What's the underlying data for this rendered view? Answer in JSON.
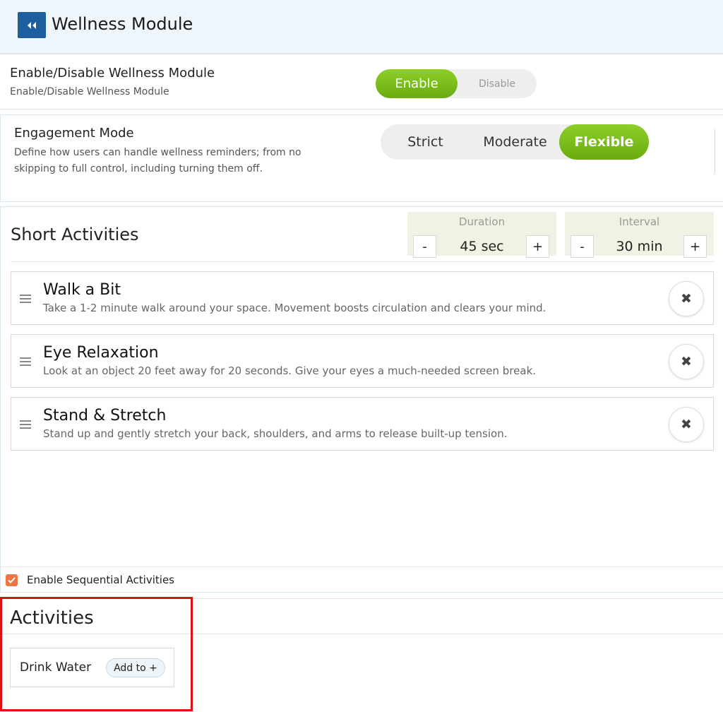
{
  "header": {
    "title": "Wellness Module",
    "back_icon": "double-chevron-left-icon"
  },
  "enable_row": {
    "title": "Enable/Disable Wellness Module",
    "subtitle": "Enable/Disable Wellness Module",
    "on_label": "Enable",
    "off_label": "Disable",
    "selected": "Enable"
  },
  "engagement": {
    "title": "Engagement Mode",
    "description_line1": "Define how users can handle wellness reminders; from no",
    "description_line2": "skipping to full control, including turning them off.",
    "options": [
      "Strict",
      "Moderate",
      "Flexible"
    ],
    "selected": "Flexible"
  },
  "short_activities": {
    "title": "Short Activities",
    "duration": {
      "label": "Duration",
      "value": "45 sec",
      "minus": "-",
      "plus": "+"
    },
    "interval": {
      "label": "Interval",
      "value": "30 min",
      "minus": "-",
      "plus": "+"
    },
    "items": [
      {
        "title": "Walk a Bit",
        "description": "Take a 1-2 minute walk around your space. Movement boosts circulation and clears your mind."
      },
      {
        "title": "Eye Relaxation",
        "description": "Look at an object 20 feet away for 20 seconds. Give your eyes a much-needed screen break."
      },
      {
        "title": "Stand & Stretch",
        "description": "Stand up and gently stretch your back, shoulders, and arms to release built-up tension."
      }
    ],
    "remove_symbol": "✖"
  },
  "sequential": {
    "label": "Enable Sequential Activities",
    "checked": true
  },
  "activities": {
    "title": "Activities",
    "items": [
      {
        "label": "Drink Water",
        "add_label": "Add to +"
      }
    ]
  },
  "colors": {
    "accent_green": "#7cbf1c",
    "header_blue": "#1d5f9c",
    "checkbox_orange": "#ee7443",
    "highlight_red": "#e01010"
  }
}
